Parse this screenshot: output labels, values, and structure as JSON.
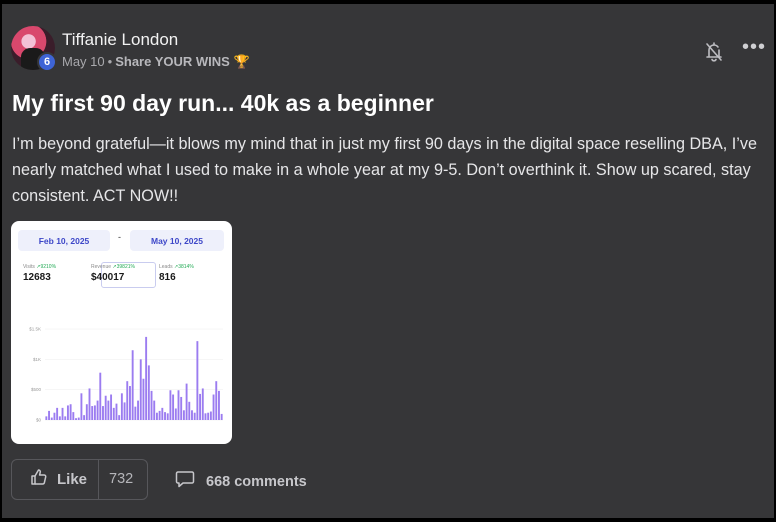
{
  "post": {
    "author": "Tiffanie London",
    "level": "6",
    "date": "May 10",
    "separator": "•",
    "category": "Share YOUR WINS",
    "category_icon": "trophy-icon",
    "title": "My first 90 day run... 40k as a beginner",
    "body": "I’m beyond grateful—it blows my mind that in just my first 90 days in the digital space reselling DBA, I’ve nearly matched what I used to make in a whole year at my 9-5. Don’t overthink it. Show up scared, stay consistent. ACT NOW!!"
  },
  "actions": {
    "like_label": "Like",
    "like_count": "732",
    "comments_label": "668 comments"
  },
  "preview": {
    "start_date": "Feb 10, 2025",
    "end_date": "May 10, 2025",
    "date_separator": "-",
    "metrics": [
      {
        "label": "Visits",
        "change": "↗9210%",
        "value": "12683"
      },
      {
        "label": "Revenue",
        "change": "↗39821%",
        "value": "$40017"
      },
      {
        "label": "Leads",
        "change": "↗3814%",
        "value": "816"
      }
    ],
    "accent": "#9b7cf0"
  },
  "chart_data": {
    "type": "bar",
    "y_ticks": [
      "$1.5K",
      "$1K",
      "$500",
      "$0"
    ],
    "ylim": [
      0,
      1500
    ],
    "values": [
      60,
      150,
      40,
      120,
      200,
      60,
      200,
      60,
      240,
      260,
      130,
      30,
      40,
      440,
      80,
      260,
      520,
      230,
      240,
      320,
      780,
      230,
      400,
      320,
      420,
      200,
      270,
      80,
      440,
      290,
      640,
      560,
      1150,
      220,
      320,
      1000,
      680,
      1370,
      900,
      480,
      320,
      120,
      150,
      200,
      130,
      110,
      490,
      420,
      190,
      490,
      380,
      160,
      600,
      300,
      160,
      120,
      1300,
      430,
      520,
      110,
      120,
      140,
      420,
      640,
      480,
      100
    ]
  }
}
